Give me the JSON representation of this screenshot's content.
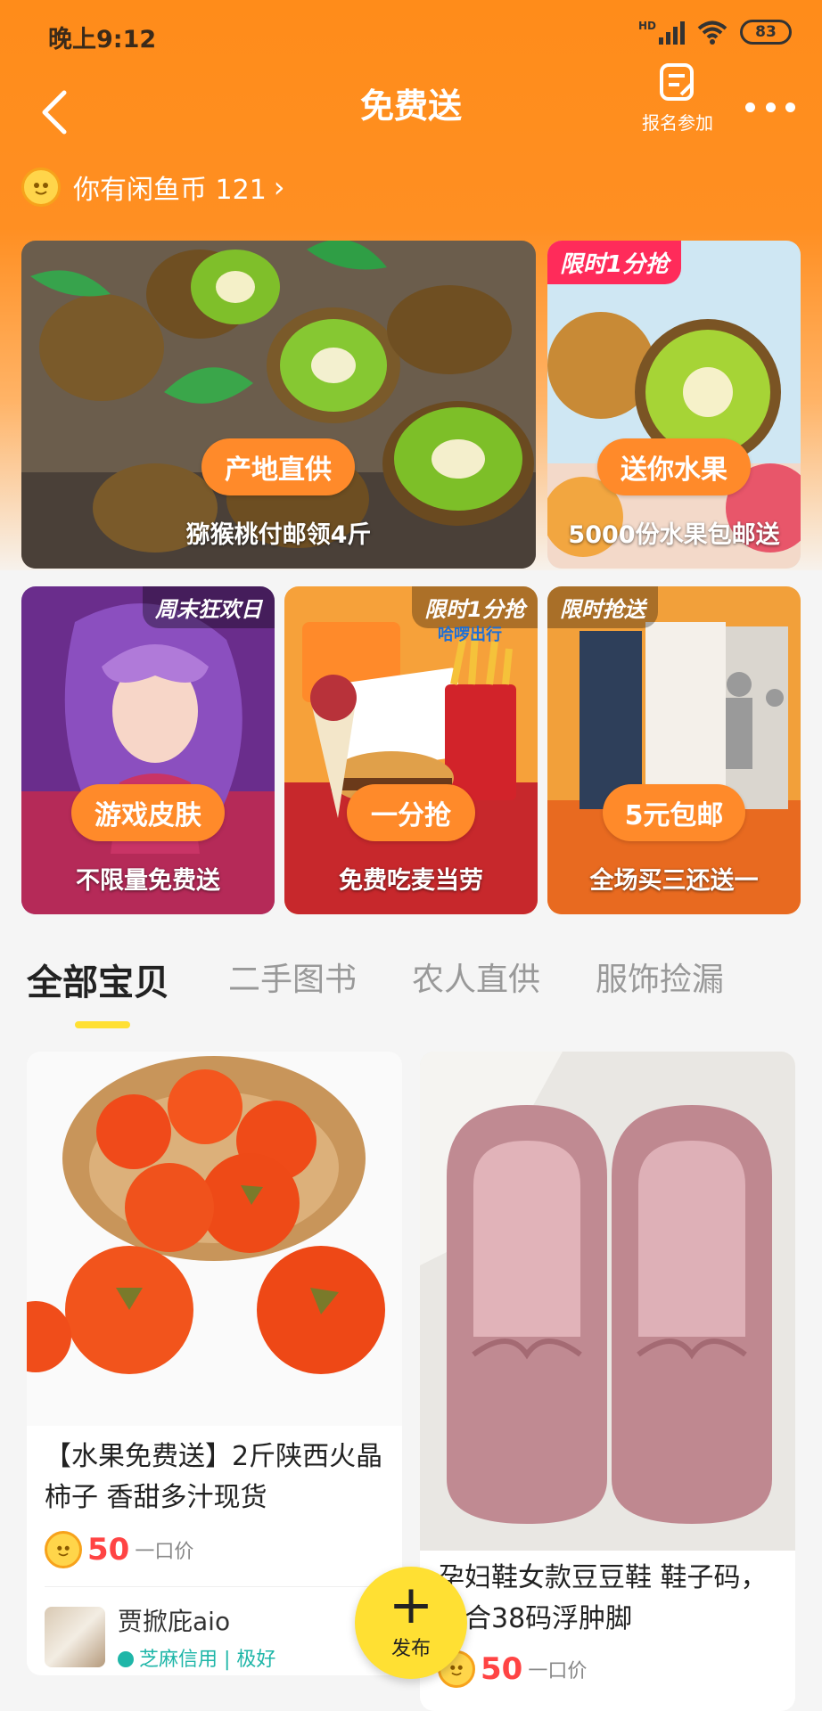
{
  "status": {
    "time": "晚上9:12",
    "network": "HD",
    "battery": "83"
  },
  "nav": {
    "title": "免费送",
    "signup_label": "报名参加"
  },
  "coins": {
    "text": "你有闲鱼币 121"
  },
  "banners": [
    {
      "pill": "产地直供",
      "caption": "猕猴桃付邮领4斤"
    },
    {
      "tag": "限时1分抢",
      "pill": "送你水果",
      "caption": "5000份水果包邮送"
    },
    {
      "tag": "周末狂欢日",
      "pill": "游戏皮肤",
      "caption": "不限量免费送"
    },
    {
      "tag": "限时1分抢",
      "sub": "哈啰出行",
      "pill": "一分抢",
      "caption": "免费吃麦当劳"
    },
    {
      "tag": "限时抢送",
      "pill": "5元包邮",
      "caption": "全场买三还送一"
    }
  ],
  "tabs": [
    "全部宝贝",
    "二手图书",
    "农人直供",
    "服饰捡漏"
  ],
  "products": [
    {
      "title": "【水果免费送】2斤陕西火晶柿子 香甜多汁现货",
      "price": "50",
      "price_unit": "一口价",
      "seller": "贾掀庇aio",
      "credit": "芝麻信用 | 极好"
    },
    {
      "title": "孕妇鞋女款豆豆鞋 鞋子码，适合38码浮肿脚",
      "price": "50",
      "price_unit": "一口价"
    }
  ],
  "fab": {
    "label": "发布"
  },
  "colors": {
    "brand": "#ff8c1a",
    "accent": "#ffe033",
    "price": "#ff4444"
  }
}
